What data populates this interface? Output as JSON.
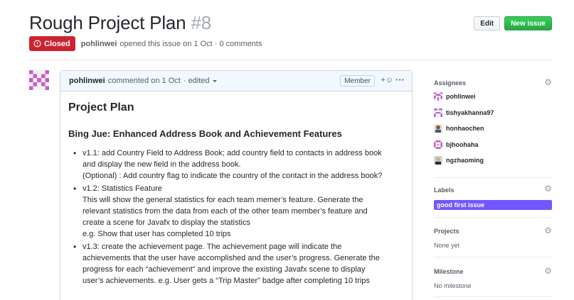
{
  "issue": {
    "title": "Rough Project Plan",
    "number": "#8",
    "state": "Closed",
    "author": "pohlinwei",
    "opened_text": "opened this issue on 1 Oct · 0 comments"
  },
  "toolbar": {
    "edit_label": "Edit",
    "new_issue_label": "New issue"
  },
  "comment": {
    "author": "pohlinwei",
    "timestamp": "commented on 1 Oct",
    "edited": "· edited",
    "role_badge": "Member",
    "react_label": "+☺",
    "more_label": "···",
    "heading": "Project Plan",
    "subheading": "Bing Jue: Enhanced Address Book and Achievement Features",
    "items": [
      {
        "lines": [
          "v1.1: add Country Field to Address Book; add country field to contacts in address book",
          "and display the new field in the address book.",
          "(Optional) : Add country flag to indicate the country of the contact in the address book?"
        ]
      },
      {
        "lines": [
          "v1.2: Statistics Feature",
          "This will show the general statistics for each team memer’s feature. Generate the",
          "relevant statistics from the data from each of the other team member’s feature and",
          "create a scene for Javafx to display the statistics",
          "e.g. Show that user has completed 10 trips"
        ]
      },
      {
        "lines": [
          "v1.3: create the achievement page. The achievement page will indicate the",
          "achievements that the user have accomplished and the user’s progress. Generate the",
          "progress for each “achievement” and improve the existing Javafx scene to display",
          "user’s achievements. e.g. User gets a “Trip Master” badge after completing 10 trips"
        ]
      }
    ]
  },
  "sidebar": {
    "assignees_title": "Assignees",
    "assignees": [
      {
        "name": "pohlinwei",
        "avatar": "pink-identicon"
      },
      {
        "name": "tishyakhanna97",
        "avatar": "purple-identicon"
      },
      {
        "name": "honhaochen",
        "avatar": "photo-avatar"
      },
      {
        "name": "bjhoohaha",
        "avatar": "pink-identicon"
      },
      {
        "name": "ngzhaoming",
        "avatar": "photo-avatar"
      }
    ],
    "labels_title": "Labels",
    "label": "good first issue",
    "label_color": "#7057ff",
    "projects_title": "Projects",
    "projects_value": "None yet",
    "milestone_title": "Milestone",
    "milestone_value": "No milestone"
  },
  "colors": {
    "closed": "#cb2431",
    "primary_button": "#28a745",
    "identicon": "#c75fc6"
  }
}
